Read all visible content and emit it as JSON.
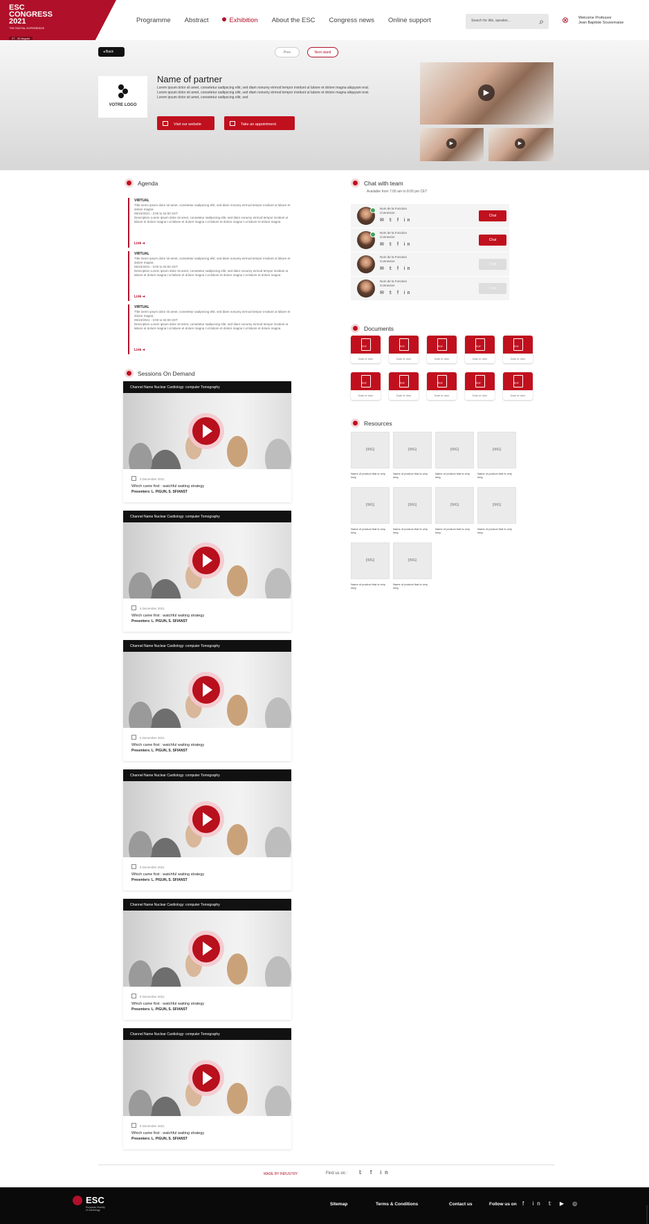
{
  "logo": {
    "line1": "ESC",
    "line2": "CONGRESS",
    "line3": "2021",
    "sub": "THE DIGITAL EXPERIENCE",
    "dates": "27 - 30 August"
  },
  "nav": {
    "items": [
      "Programme",
      "Abstract",
      "Exhibition",
      "About the ESC",
      "Congress news",
      "Online support"
    ],
    "active": "Exhibition"
  },
  "search": {
    "placeholder": "Search for title, speaker..."
  },
  "user": {
    "line1": "Welcome Professor",
    "line2": "Jean Baptiste Souvernaise"
  },
  "topbar": {
    "back": "Back",
    "pill1": "Prev",
    "pill2": "Next stand"
  },
  "partner": {
    "logo_text": "VOTRE LOGO",
    "name": "Name of partner",
    "description": "Lorem ipsum dolor sit amet, consetetur sadipscing elitr, sed diam nonumy eirmod tempor invidunt ut labore et dolore magna aliquyam erat. Lorem ipsum dolor sit amet, consetetur sadipscing elitr, sed diam nonumy eirmod tempor invidunt ut labore et dolore magna aliquyam erat. Lorem ipsum dolor sit amet, consetetur sadipscing elitr, sed",
    "visit_btn": "Visit our website",
    "appointment_btn": "Take an appointment"
  },
  "agenda": {
    "heading": "Agenda",
    "items": [
      {
        "type": "VIRTUAL",
        "title": "Title lorem ipsum dolor sit amet, consetetur sadipscing elitr, sed diam nonumy eirmod tempor invidunt ut labore et dolore magna",
        "time": "05/10/2021 - 3:00 to 04:00 CET",
        "desc": "Description Lorem ipsum dolor sit amet, consetetur sadipscing elitr, sed diam nonumy eirmod tempor invidunt ut labore et dolore magna t ut labore et dolore magna t ut labore et dolore magna t ut labore et dolore magna",
        "link": "Link"
      },
      {
        "type": "VIRTUAL",
        "title": "Title lorem ipsum dolor sit amet, consetetur sadipscing elitr, sed diam nonumy eirmod tempor invidunt ut labore et dolore magna",
        "time": "05/10/2021 - 3:00 to 04:00 CET",
        "desc": "Description Lorem ipsum dolor sit amet, consetetur sadipscing elitr, sed diam nonumy eirmod tempor invidunt ut labore et dolore magna t ut labore et dolore magna t ut labore et dolore magna t ut labore et dolore magna",
        "link": "Link"
      },
      {
        "type": "VIRTUAL",
        "title": "Title lorem ipsum dolor sit amet, consetetur sadipscing elitr, sed diam nonumy eirmod tempor invidunt ut labore et dolore magna",
        "time": "05/10/2021 - 3:00 to 04:00 CET",
        "desc": "Description Lorem ipsum dolor sit amet, consetetur sadipscing elitr, sed diam nonumy eirmod tempor invidunt ut labore et dolore magna t ut labore et dolore magna t ut labore et dolore magna t ut labore et dolore magna",
        "link": "Link"
      }
    ]
  },
  "sessions": {
    "heading": "Sessions On Demand",
    "items": [
      {
        "channel": "Channel Name Nuclear Cardiology: computer Tomography",
        "date": "5 December 2021",
        "title": "Which came first : watchful waiting strategy",
        "presenters": "Presenters: L. PIGUN, S. SFIANST"
      },
      {
        "channel": "Channel Name Nuclear Cardiology: computer Tomography",
        "date": "5 December 2021",
        "title": "Which came first : watchful waiting strategy",
        "presenters": "Presenters: L. PIGUN, S. SFIANST"
      },
      {
        "channel": "Channel Name Nuclear Cardiology: computer Tomography",
        "date": "5 December 2021",
        "title": "Which came first : watchful waiting strategy",
        "presenters": "Presenters: L. PIGUN, S. SFIANST"
      },
      {
        "channel": "Channel Name Nuclear Cardiology: computer Tomography",
        "date": "5 December 2021",
        "title": "Which came first : watchful waiting strategy",
        "presenters": "Presenters: L. PIGUN, S. SFIANST"
      },
      {
        "channel": "Channel Name Nuclear Cardiology: computer Tomography",
        "date": "5 December 2021",
        "title": "Which came first : watchful waiting strategy",
        "presenters": "Presenters: L. PIGUN, S. SFIANST"
      },
      {
        "channel": "Channel Name Nuclear Cardiology: computer Tomography",
        "date": "5 December 2021",
        "title": "Which came first : watchful waiting strategy",
        "presenters": "Presenters: L. PIGUN, S. SFIANST"
      }
    ]
  },
  "chat": {
    "heading": "Chat with team",
    "available": "Available from 7:00 am to 8:00 pm CET",
    "members": [
      {
        "name": "Nom de la Fonction",
        "title": "Connexion",
        "social": "✉ 𝕥 f in",
        "button": "Chat",
        "online": true
      },
      {
        "name": "Nom de la Fonction",
        "title": "Connexion",
        "social": "✉ 𝕥 f in",
        "button": "Chat",
        "online": true
      },
      {
        "name": "Nom de la Fonction",
        "title": "Connexion",
        "social": "✉ 𝕥 f in",
        "button": "Chat",
        "online": false
      },
      {
        "name": "Nom de la Fonction",
        "title": "Connexion",
        "social": "✉ 𝕥 f in",
        "button": "Chat",
        "online": false
      }
    ]
  },
  "documents": {
    "heading": "Documents",
    "items": [
      "Date et dmn",
      "Date et dmn",
      "Date et dmn",
      "Date et dmn",
      "Date et dmn",
      "Date et dmn",
      "Date et dmn",
      "Date et dmn",
      "Date et dmn",
      "Date et dmn"
    ]
  },
  "resources": {
    "heading": "Resources",
    "items": [
      {
        "img": "[IMG]",
        "text": "Name of product that is very long"
      },
      {
        "img": "[IMG]",
        "text": "Name of product that is very long"
      },
      {
        "img": "[IMG]",
        "text": "Name of product that is very long"
      },
      {
        "img": "[IMG]",
        "text": "Name of product that is very long"
      },
      {
        "img": "[IMG]",
        "text": "Name of product that is very long"
      },
      {
        "img": "[IMG]",
        "text": "Name of product that is very long"
      },
      {
        "img": "[IMG]",
        "text": "Name of product that is very long"
      },
      {
        "img": "[IMG]",
        "text": "Name of product that is very long"
      },
      {
        "img": "[IMG]",
        "text": "Name of product that is very long"
      },
      {
        "img": "[IMG]",
        "text": "Name of product that is very long"
      }
    ]
  },
  "strip": {
    "made_by": "MADE BY INDUSTRY",
    "follow": "Find us on :",
    "icons": "𝕥 f in"
  },
  "footer": {
    "logo": "ESC",
    "logo_sub": "European Society of Cardiology",
    "links": [
      "Sitemap",
      "Terms & Conditions",
      "Contact us"
    ],
    "follow": "Follow us on",
    "icons": "f in 𝕥 ▶ ◎"
  },
  "colors": {
    "brand_red": "#b0102a",
    "button_red": "#c0101e",
    "footer_bg": "#0a0a0a"
  }
}
